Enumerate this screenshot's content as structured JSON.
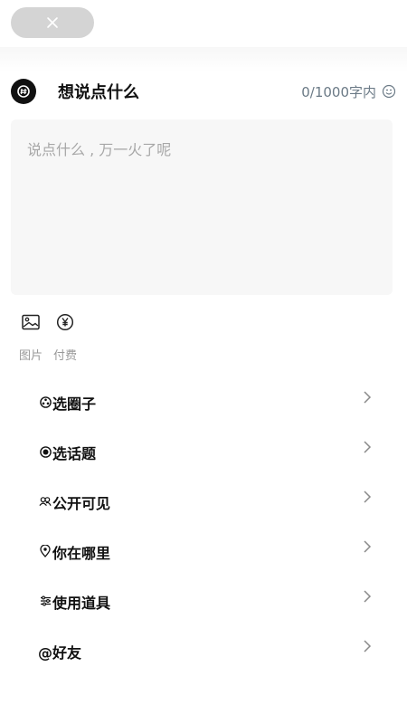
{
  "header": {
    "title": "想说点什么",
    "counter": "0/1000字内"
  },
  "editor": {
    "placeholder": "说点什么 , 万一火了呢"
  },
  "tools": [
    {
      "label": "图片",
      "icon": "image-icon"
    },
    {
      "label": "付费",
      "icon": "yen-icon"
    }
  ],
  "options": [
    {
      "label": "选圈子",
      "icon": "circle-icon"
    },
    {
      "label": "选话题",
      "icon": "topic-icon"
    },
    {
      "label": "公开可见",
      "icon": "people-icon"
    },
    {
      "label": "你在哪里",
      "icon": "location-icon"
    },
    {
      "label": "使用道具",
      "icon": "props-icon"
    },
    {
      "label": "@好友",
      "icon": ""
    }
  ],
  "colors": {
    "accent": "#111111",
    "counter": "#6b7a86",
    "placeholder": "#a7a7a7",
    "input_bg": "#f7f7f7",
    "pill_bg": "#d4d4d4"
  }
}
